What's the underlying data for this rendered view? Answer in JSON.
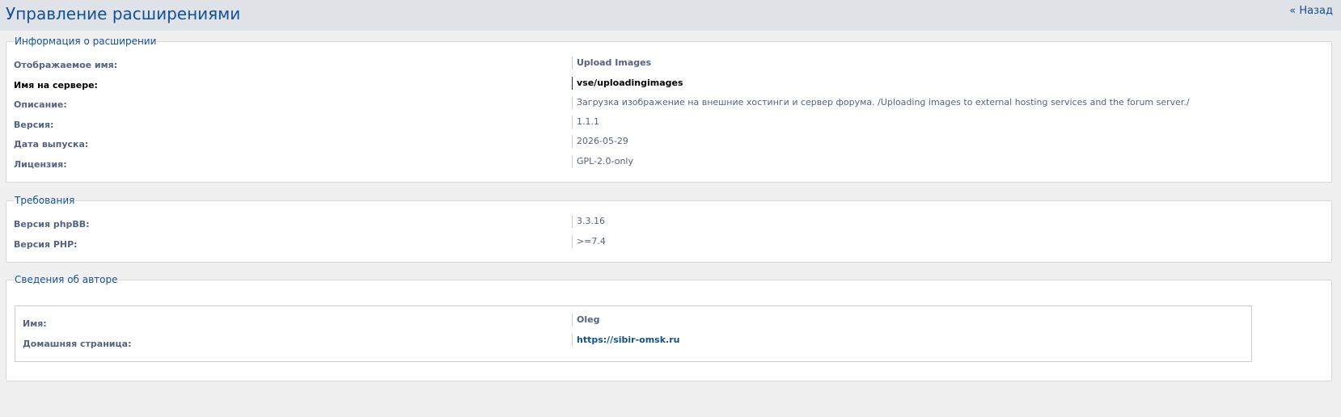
{
  "page": {
    "title": "Управление расширениями",
    "back_link": "« Назад"
  },
  "ext_info": {
    "legend": "Информация о расширении",
    "rows": [
      {
        "label": "Отображаемое имя:",
        "value": "Upload Images"
      },
      {
        "label": "Имя на сервере:",
        "value": "vse/uploadingimages"
      },
      {
        "label": "Описание:",
        "value": "Загрузка изображение на внешние хостинги и сервер форума. /Uploading images to external hosting services and the forum server./"
      },
      {
        "label": "Версия:",
        "value": "1.1.1"
      },
      {
        "label": "Дата выпуска:",
        "value": "2026-05-29"
      },
      {
        "label": "Лицензия:",
        "value": "GPL-2.0-only"
      }
    ]
  },
  "requirements": {
    "legend": "Требования",
    "rows": [
      {
        "label": "Версия phpBB:",
        "value": "3.3.16"
      },
      {
        "label": "Версия PHP:",
        "value": ">=7.4"
      }
    ]
  },
  "author": {
    "legend": "Сведения об авторе",
    "rows": [
      {
        "label": "Имя:",
        "value": "Oleg"
      },
      {
        "label": "Домашняя страница:",
        "value": "https://sibir-omsk.ru"
      }
    ]
  },
  "colors": {
    "title": "#115098",
    "label": "#536482",
    "link": "#105289",
    "panel_bg": "#ffffff",
    "page_bg": "#f0f0f0",
    "header_bg": "#dfe3e8"
  }
}
